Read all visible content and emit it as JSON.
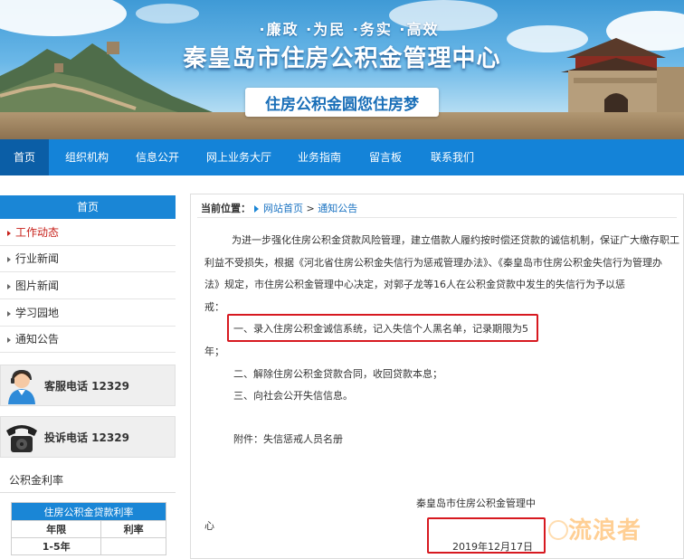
{
  "header": {
    "slogan": "·廉政 ·为民 ·务实 ·高效",
    "site_title": "秦皇岛市住房公积金管理中心",
    "motto": "住房公积金圆您住房梦"
  },
  "nav": {
    "items": [
      {
        "label": "首页",
        "active": true
      },
      {
        "label": "组织机构"
      },
      {
        "label": "信息公开"
      },
      {
        "label": "网上业务大厅"
      },
      {
        "label": "业务指南"
      },
      {
        "label": "留言板"
      },
      {
        "label": "联系我们"
      }
    ]
  },
  "sidebar": {
    "title": "首页",
    "items": [
      {
        "label": "工作动态",
        "active": true
      },
      {
        "label": "行业新闻"
      },
      {
        "label": "图片新闻"
      },
      {
        "label": "学习园地"
      },
      {
        "label": "通知公告"
      }
    ],
    "hotlines": [
      {
        "label": "客服电话 12329",
        "icon": "customer-service-icon"
      },
      {
        "label": "投诉电话 12329",
        "icon": "telephone-icon"
      }
    ],
    "rates": {
      "title": "公积金利率",
      "caption": "住房公积金贷款利率",
      "columns": [
        "年限",
        "利率"
      ],
      "rows": [
        [
          "1-5年",
          ""
        ]
      ]
    }
  },
  "breadcrumb": {
    "prefix": "当前位置：",
    "home": "网站首页",
    "sep": ">",
    "current": "通知公告"
  },
  "article": {
    "lines": [
      "为进一步强化住房公积金贷款风险管理，建立借款人履约按时偿还贷款的诚信机制，保证广大缴存职工",
      "利益不受损失，根据《河北省住房公积金失信行为惩戒管理办法》、《秦皇岛市住房公积金失信行为管理办",
      "法》规定，市住房公积金管理中心决定，对郭子龙等16人在公积金贷款中发生的失信行为予以惩",
      "戒："
    ],
    "measures": [
      "一、录入住房公积金诚信系统，记入失信个人黑名单，记录期限为5",
      "年；",
      "二、解除住房公积金贷款合同，收回贷款本息；",
      "三、向社会公开失信信息。"
    ],
    "attachment": "附件：失信惩戒人员名册",
    "signature_a": "秦皇岛市住房公积金管理中",
    "signature_b": "心",
    "date": "2019年12月17日"
  },
  "watermark": "流浪者",
  "colors": {
    "nav": "#1483d8",
    "nav_active": "#0b5ea6",
    "highlight": "#d71920",
    "link": "#1a73c2"
  }
}
